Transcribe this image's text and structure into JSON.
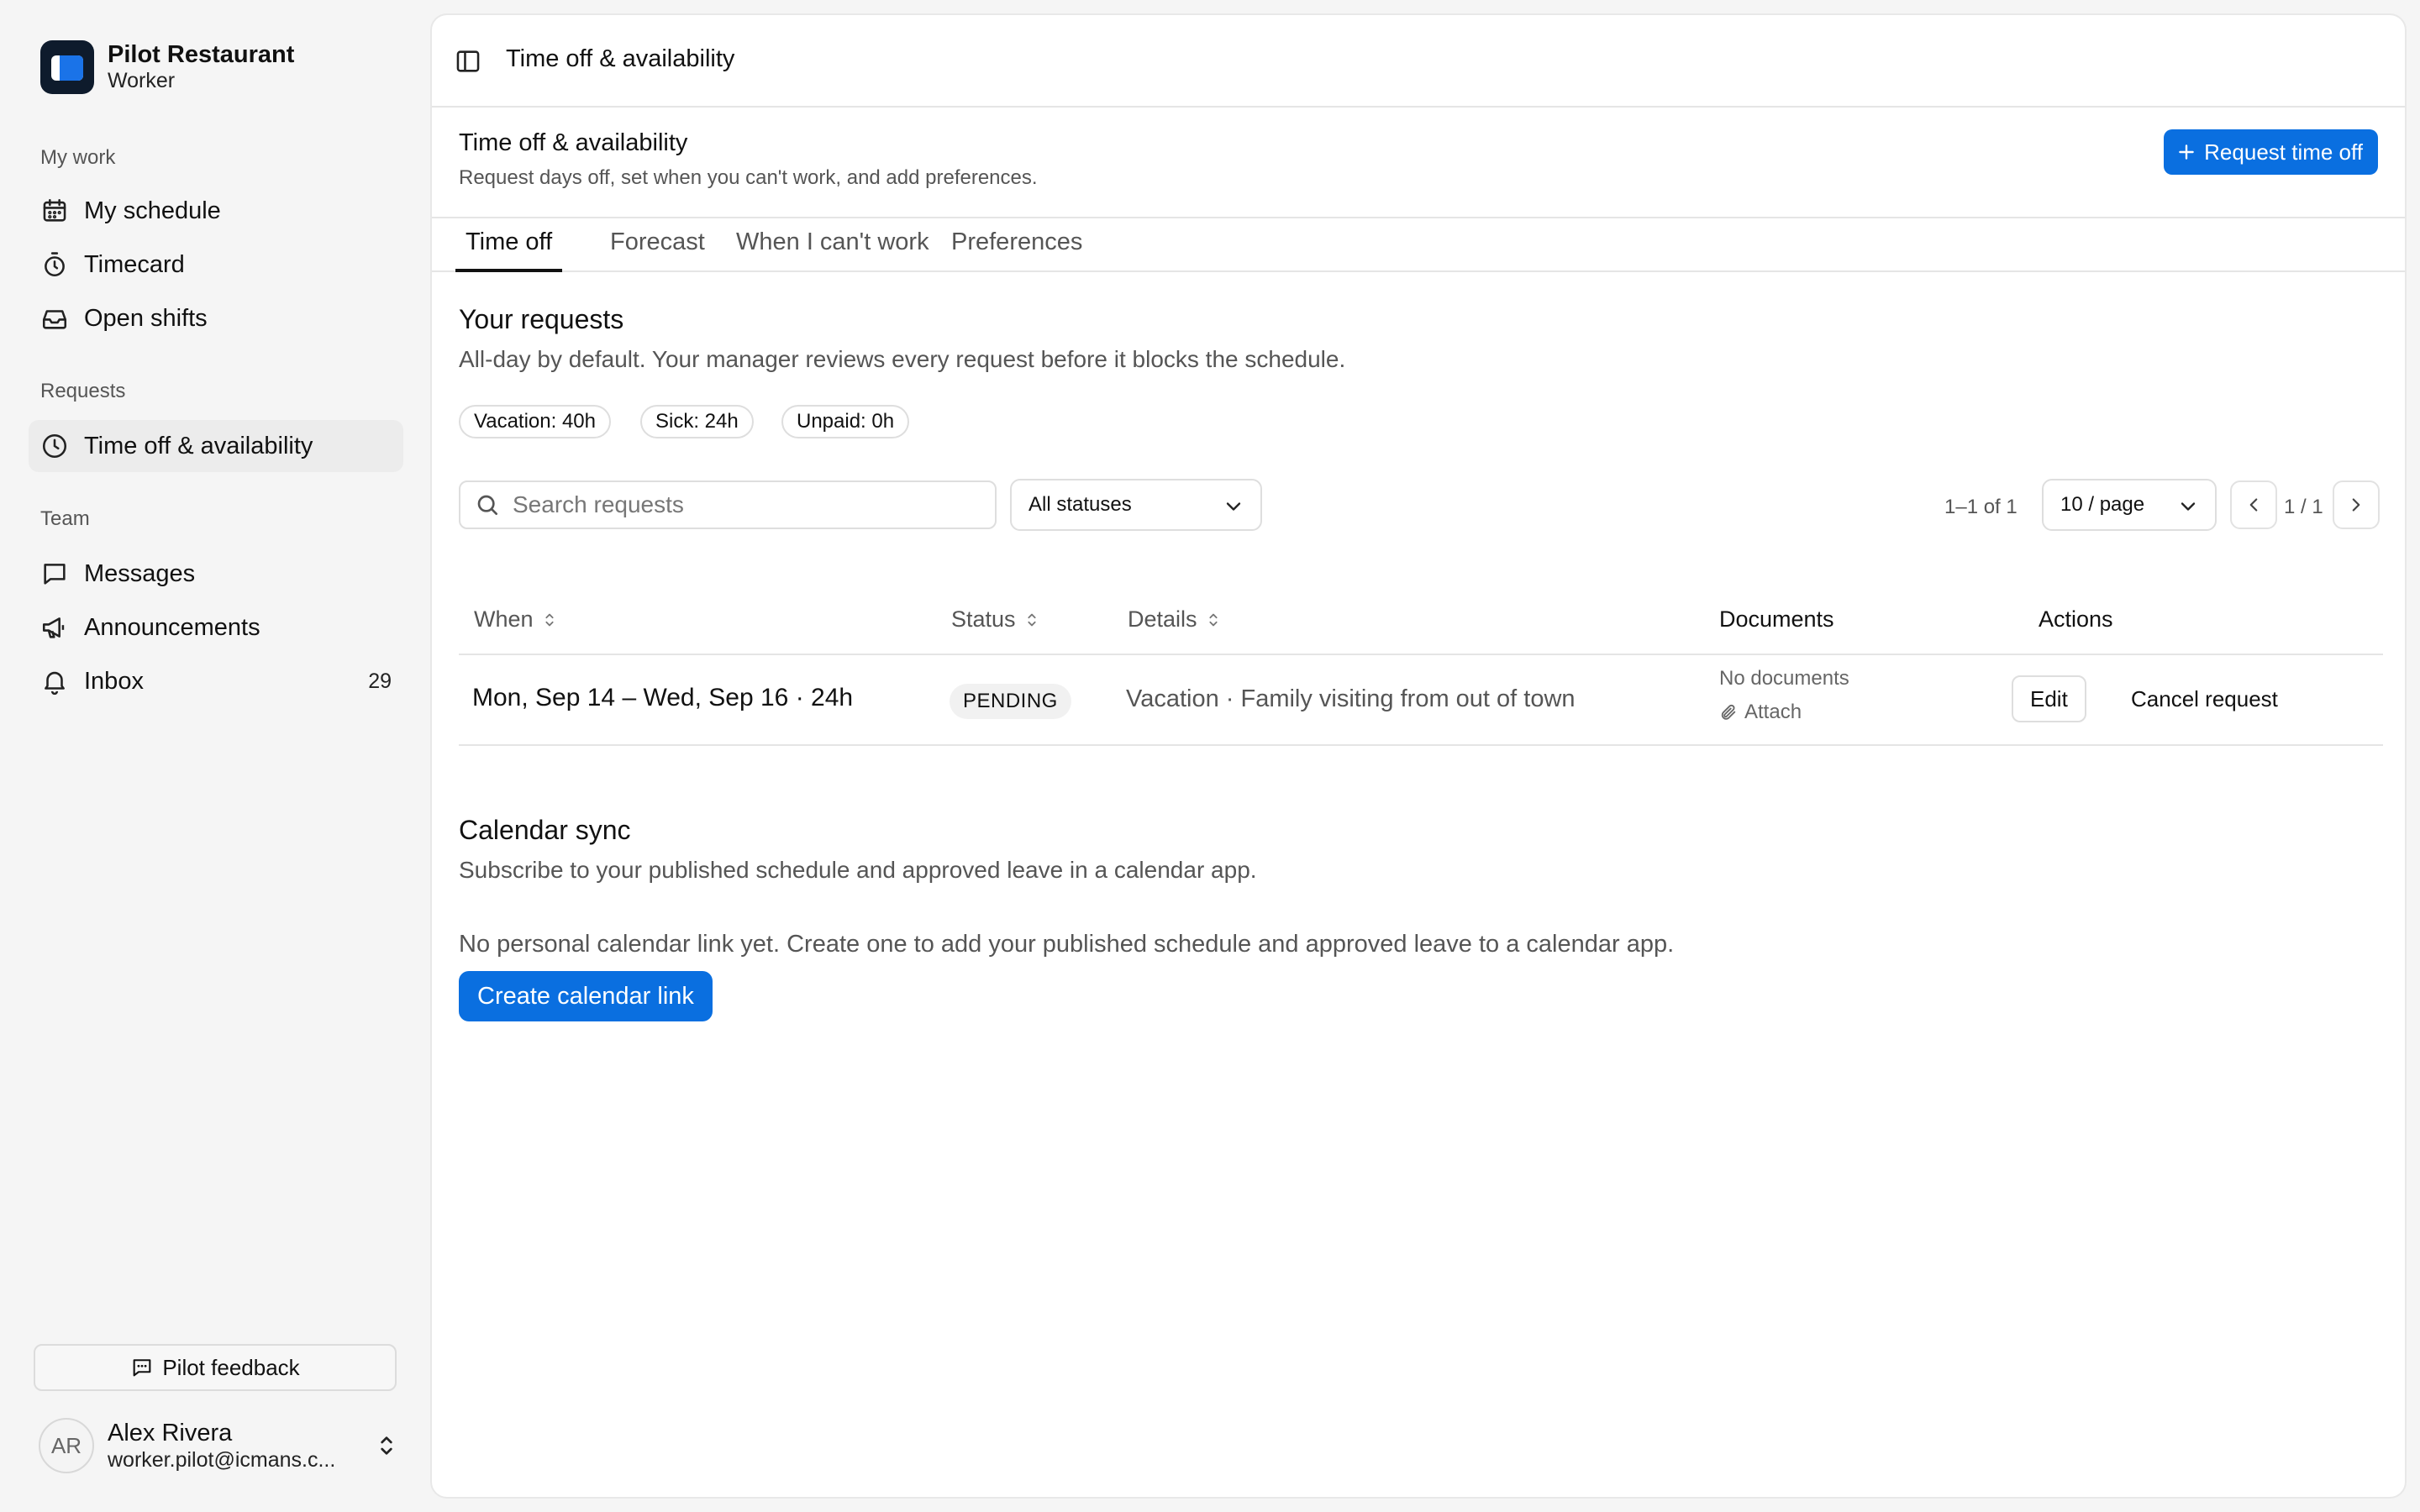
{
  "brand": {
    "name": "Pilot Restaurant",
    "role": "Worker"
  },
  "sidebar": {
    "sections": [
      {
        "label": "My work"
      },
      {
        "label": "Requests"
      },
      {
        "label": "Team"
      }
    ],
    "items": [
      {
        "label": "My schedule",
        "icon": "calendar-icon"
      },
      {
        "label": "Timecard",
        "icon": "stopwatch-icon"
      },
      {
        "label": "Open shifts",
        "icon": "inbox-tray-icon"
      },
      {
        "label": "Time off & availability",
        "icon": "clock-icon",
        "active": true
      },
      {
        "label": "Messages",
        "icon": "message-icon"
      },
      {
        "label": "Announcements",
        "icon": "megaphone-icon"
      },
      {
        "label": "Inbox",
        "icon": "bell-icon",
        "count": "29"
      }
    ],
    "feedback_label": "Pilot feedback",
    "user": {
      "initials": "AR",
      "name": "Alex Rivera",
      "email": "worker.pilot@icmans.c..."
    }
  },
  "topbar": {
    "title": "Time off & availability"
  },
  "page": {
    "title": "Time off & availability",
    "subtitle": "Request days off, set when you can't work, and add preferences.",
    "primary_action": "Request time off"
  },
  "tabs": [
    {
      "label": "Time off",
      "active": true
    },
    {
      "label": "Forecast"
    },
    {
      "label": "When I can't work"
    },
    {
      "label": "Preferences"
    }
  ],
  "requests": {
    "title": "Your requests",
    "description": "All-day by default. Your manager reviews every request before it blocks the schedule.",
    "balances": [
      "Vacation: 40h",
      "Sick: 24h",
      "Unpaid: 0h"
    ],
    "search_placeholder": "Search requests",
    "search_value": "",
    "status_filter": "All statuses",
    "range": "1–1 of 1",
    "page_size": "10 / page",
    "page": "1 / 1",
    "columns": [
      "When",
      "Status",
      "Details",
      "Documents",
      "Actions"
    ],
    "rows": [
      {
        "when": "Mon, Sep 14 – Wed, Sep 16 · 24h",
        "status": "PENDING",
        "details": "Vacation · Family visiting from out of town",
        "documents": "No documents",
        "attach": "Attach",
        "edit": "Edit",
        "cancel": "Cancel request"
      }
    ]
  },
  "calendar": {
    "title": "Calendar sync",
    "description": "Subscribe to your published schedule and approved leave in a calendar app.",
    "empty_text": "No personal calendar link yet. Create one to add your published schedule and approved leave to a calendar app.",
    "button": "Create calendar link"
  },
  "colors": {
    "accent": "#0a6fe0",
    "brand_dark": "#0e1b2c"
  }
}
